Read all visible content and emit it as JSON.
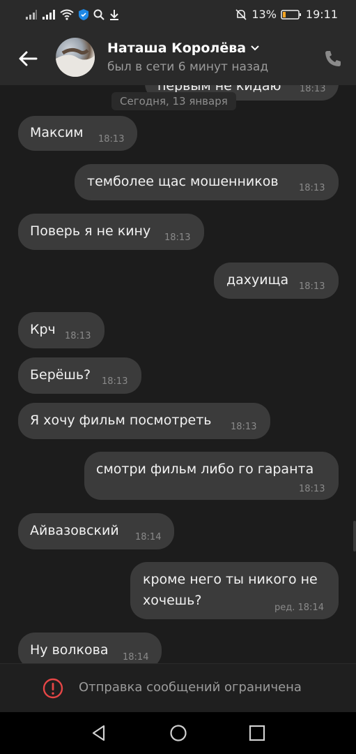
{
  "status_bar": {
    "battery_percent": "13%",
    "time": "19:11",
    "icons": [
      "signal-icon",
      "signal-icon-2",
      "wifi-icon",
      "shield-icon",
      "search-icon",
      "download-icon",
      "mute-icon",
      "battery-icon"
    ]
  },
  "header": {
    "contact_name": "Наташа Королёва",
    "last_seen": "был в сети 6 минут назад",
    "icons": [
      "back-arrow-icon",
      "chevron-down-icon",
      "phone-icon"
    ]
  },
  "chat": {
    "date_divider": "Сегодня, 13 января",
    "top_cut_message": {
      "text": "первым не кидаю",
      "time": "18:13"
    },
    "messages": [
      {
        "side": "in",
        "text": "Максим",
        "time": "18:13"
      },
      {
        "side": "out",
        "text": "темболее щас мошенников",
        "time": "18:13"
      },
      {
        "side": "in",
        "text": "Поверь я не кину",
        "time": "18:13"
      },
      {
        "side": "out",
        "text": "дахуища",
        "time": "18:13"
      },
      {
        "side": "in",
        "text": "Крч",
        "time": "18:13"
      },
      {
        "side": "in",
        "text": "Берёшь?",
        "time": "18:13"
      },
      {
        "side": "in",
        "text": "Я хочу фильм посмотреть",
        "time": "18:13"
      },
      {
        "side": "out",
        "text": "смотри фильм либо го гаранта",
        "time": "18:13"
      },
      {
        "side": "in",
        "text": "Айвазовский",
        "time": "18:14"
      },
      {
        "side": "out",
        "text_line1": "кроме него ты никого не",
        "text_line2": "хочешь?",
        "time": "ред. 18:14"
      },
      {
        "side": "in",
        "text": "Ну волкова",
        "time": "18:14"
      }
    ]
  },
  "footer": {
    "restriction_text": "Отправка сообщений ограничена",
    "icon": "warning-icon"
  },
  "nav_bar": {
    "icons": [
      "back-triangle-icon",
      "home-circle-icon",
      "recents-square-icon"
    ]
  }
}
